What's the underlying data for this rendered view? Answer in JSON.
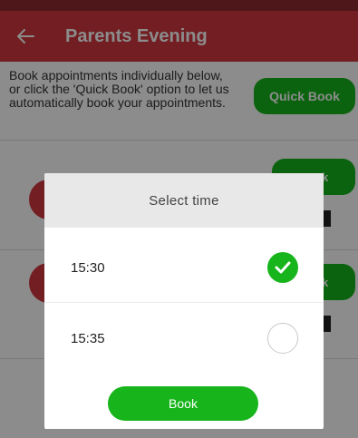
{
  "app_bar": {
    "title": "Parents Evening",
    "back_icon": "back-arrow-icon",
    "color": "#d0373f"
  },
  "intro": {
    "text": "Book appointments individually below, or click the 'Quick Book' option to let us automatically book your appointments.",
    "quick_book_label": "Quick Book"
  },
  "rows": [
    {
      "book_label": "Book"
    },
    {
      "book_label": "Book"
    }
  ],
  "dialog": {
    "title": "Select time",
    "options": [
      {
        "time": "15:30",
        "selected": true
      },
      {
        "time": "15:35",
        "selected": false
      }
    ],
    "book_label": "Book"
  },
  "colors": {
    "primary_green": "#17b41c",
    "brand_red": "#d0373f"
  }
}
